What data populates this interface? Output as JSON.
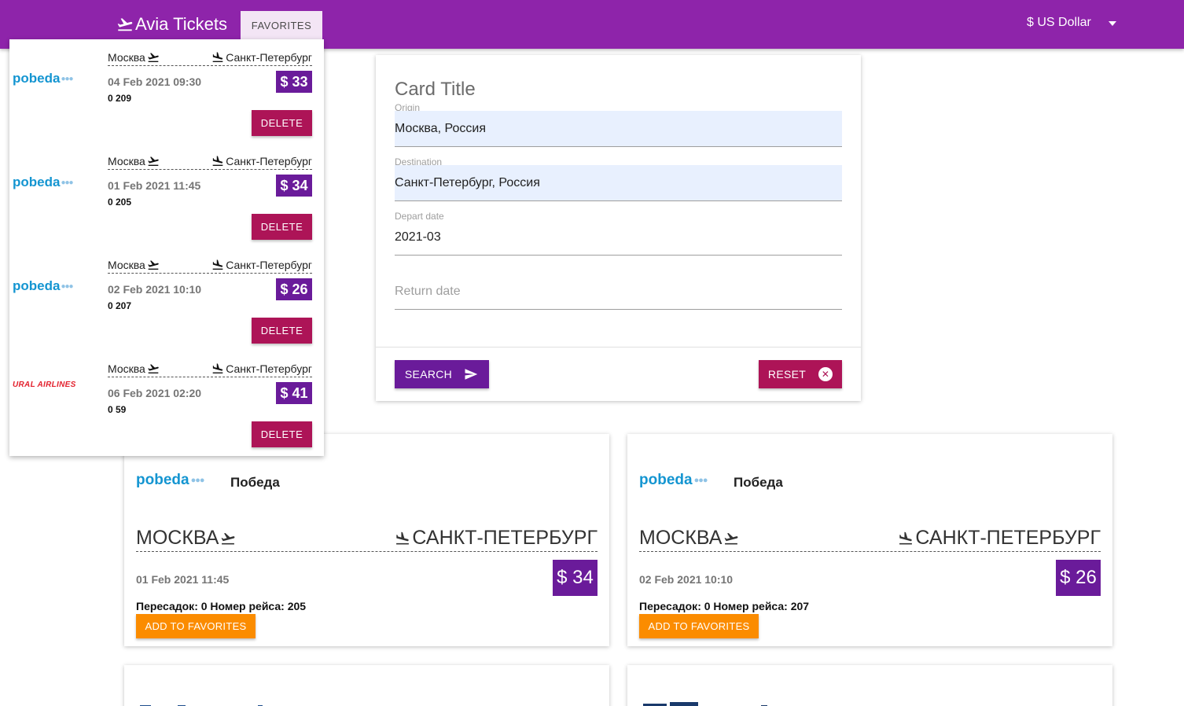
{
  "navbar": {
    "brand": "Avia Tickets",
    "favorites_label": "FAVORITES",
    "currency": "$ US Dollar"
  },
  "favorites": [
    {
      "airline_logo": "pobeda",
      "origin": "Москва",
      "destination": "Санкт-Петербург",
      "date": "04 Feb 2021 09:30",
      "price": "$ 33",
      "meta": "0 209",
      "delete_label": "DELETE"
    },
    {
      "airline_logo": "pobeda",
      "origin": "Москва",
      "destination": "Санкт-Петербург",
      "date": "01 Feb 2021 11:45",
      "price": "$ 34",
      "meta": "0 205",
      "delete_label": "DELETE"
    },
    {
      "airline_logo": "pobeda",
      "origin": "Москва",
      "destination": "Санкт-Петербург",
      "date": "02 Feb 2021 10:10",
      "price": "$ 26",
      "meta": "0 207",
      "delete_label": "DELETE"
    },
    {
      "airline_logo": "URAL AIRLINES",
      "origin": "Москва",
      "destination": "Санкт-Петербург",
      "date": "06 Feb 2021 02:20",
      "price": "$ 41",
      "meta": "0 59",
      "delete_label": "DELETE"
    }
  ],
  "search_form": {
    "title": "Card Title",
    "origin": {
      "label": "Origin",
      "value": "Москва, Россия"
    },
    "destination": {
      "label": "Destination",
      "value": "Санкт-Петербург, Россия"
    },
    "depart": {
      "label": "Depart date",
      "value": "2021-03"
    },
    "return": {
      "placeholder": "Return date"
    },
    "search_label": "SEARCH",
    "reset_label": "RESET"
  },
  "logo_text": {
    "pobeda": "pobeda",
    "pobeda_dots": "●●●"
  },
  "results": [
    {
      "airline_logo": "pobeda",
      "airline_name": "Победа",
      "origin": "МОСКВА",
      "destination": "САНКТ-ПЕТЕРБУРГ",
      "date": "01 Feb 2021 11:45",
      "price": "$ 34",
      "meta": "Пересадок: 0 Номер рейса: 205",
      "button_label": "ADD TO FAVORITES"
    },
    {
      "airline_logo": "pobeda",
      "airline_name": "Победа",
      "origin": "МОСКВА",
      "destination": "САНКТ-ПЕТЕРБУРГ",
      "date": "02 Feb 2021 10:10",
      "price": "$ 26",
      "meta": "Пересадок: 0 Номер рейса: 207",
      "button_label": "ADD TO FAVORITES"
    }
  ],
  "colors": {
    "navbar": "#8e24aa",
    "primary": "#6a1b9a",
    "danger": "#ad1457",
    "accent": "#fb8c00",
    "input_fill": "#e8f0fe",
    "pobeda_blue": "#1495d1",
    "ural_red": "#e3222e"
  },
  "icons": {
    "brand": "plane-takeoff-icon",
    "takeoff": "plane-takeoff-icon",
    "landing": "plane-landing-icon",
    "search": "send-icon",
    "reset": "close-circle-icon",
    "currency": "caret-down-icon"
  }
}
